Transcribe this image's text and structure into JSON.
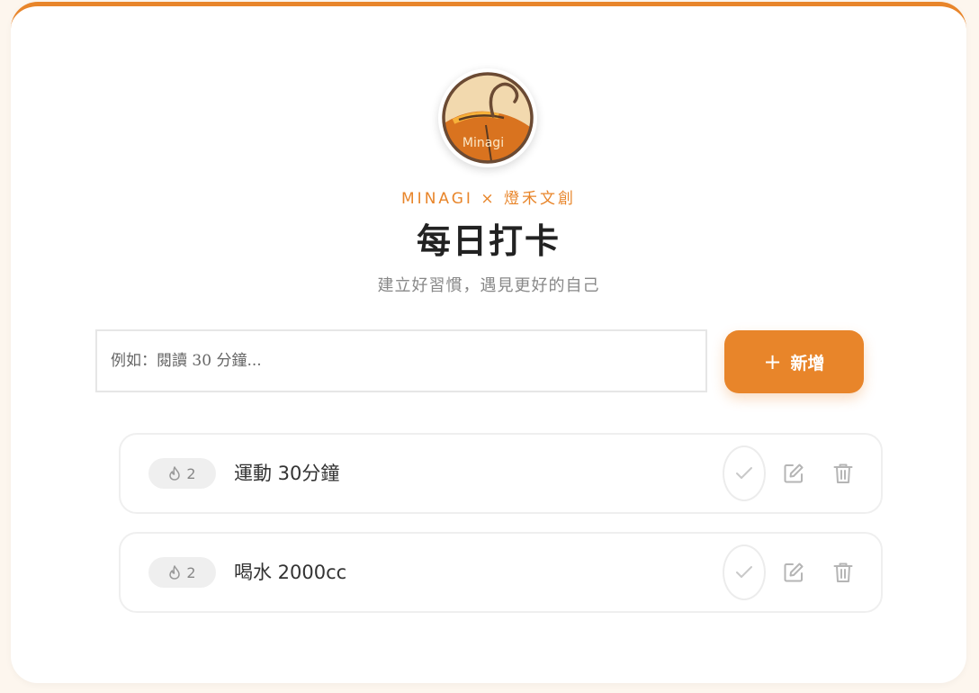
{
  "header": {
    "logo_text": "Minagi",
    "brand": "MINAGI × 燈禾文創",
    "title": "每日打卡",
    "subtitle": "建立好習慣，遇見更好的自己"
  },
  "form": {
    "input_placeholder": "例如：閱讀 30 分鐘...",
    "input_value": "",
    "add_icon": "plus-icon",
    "add_label": "新增"
  },
  "habits": [
    {
      "streak": "2",
      "streak_icon": "flame-icon",
      "name": "運動 30分鐘"
    },
    {
      "streak": "2",
      "streak_icon": "flame-icon",
      "name": "喝水 2000cc"
    }
  ],
  "row_actions": [
    "check-icon",
    "edit-icon",
    "trash-icon"
  ],
  "colors": {
    "accent": "#e8852a",
    "background": "#fdf6ee",
    "title": "#222222",
    "muted": "#888888",
    "icon_gray": "#bbbbbb"
  }
}
